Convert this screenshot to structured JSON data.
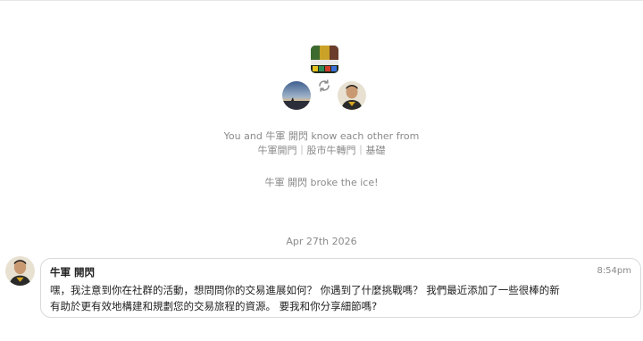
{
  "intro": {
    "community_icon": "community-logo",
    "sync_icon": "sync-icon",
    "know_text": "You and 牛軍 開閃 know each other from",
    "groups_text": "牛軍開門｜股市牛轉門｜基礎",
    "ice_text": "牛軍 開閃 broke the ice!"
  },
  "date_separator": "Apr 27th 2026",
  "message": {
    "sender": "牛軍 開閃",
    "time": "8:54pm",
    "lines": [
      "嘿，我注意到你在社群的活動，想問問你的交易進展如何？ 你遇到了什麼挑戰嗎？ 我們最近添加了一些很棒的新",
      "有助於更有效地構建和規劃您的交易旅程的資源。 要我和你分享細節嗎?"
    ]
  },
  "colors": {
    "muted_text": "#8a8a8a",
    "border": "#d9d9d9",
    "sync": "#8f8f8f"
  }
}
